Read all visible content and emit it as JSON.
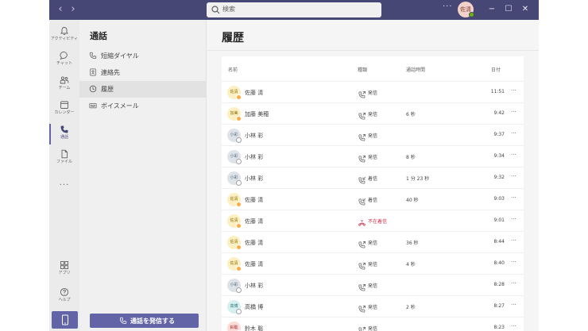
{
  "titlebar": {
    "search_placeholder": "検索",
    "more": "···",
    "avatar_initials": "佐清",
    "back_icon": "‹",
    "forward_icon": "›",
    "minimize": "−",
    "maximize": "☐",
    "close": "✕"
  },
  "appbar": {
    "items": [
      {
        "label": "アクティビティ",
        "icon": "bell-icon"
      },
      {
        "label": "チャット",
        "icon": "chat-icon"
      },
      {
        "label": "チーム",
        "icon": "teams-icon"
      },
      {
        "label": "カレンダー",
        "icon": "calendar-icon"
      },
      {
        "label": "通話",
        "icon": "phone-icon"
      },
      {
        "label": "ファイル",
        "icon": "file-icon"
      }
    ],
    "more": "···",
    "bottom": [
      {
        "label": "アプリ",
        "icon": "apps-icon"
      },
      {
        "label": "ヘルプ",
        "icon": "help-icon"
      }
    ]
  },
  "leftpanel": {
    "title": "通話",
    "items": [
      {
        "label": "短縮ダイヤル",
        "icon": "phone-icon"
      },
      {
        "label": "連絡先",
        "icon": "contact-card-icon"
      },
      {
        "label": "履歴",
        "icon": "clock-icon"
      },
      {
        "label": "ボイスメール",
        "icon": "voicemail-icon"
      }
    ],
    "call_button": "通話を発信する"
  },
  "main": {
    "title": "履歴",
    "columns": {
      "name": "名前",
      "type": "種類",
      "duration": "通話時間",
      "date": "日付"
    },
    "rows": [
      {
        "initials": "佐清",
        "name": "佐藤 清",
        "type": "発信",
        "duration": "",
        "date": "11:51",
        "avatar": "yellow",
        "presence": "away",
        "missed": false
      },
      {
        "initials": "加美",
        "name": "加藤 美穂",
        "type": "発信",
        "duration": "6 秒",
        "date": "9:42",
        "avatar": "yellow",
        "presence": "away",
        "missed": false
      },
      {
        "initials": "小彩",
        "name": "小林 彩",
        "type": "発信",
        "duration": "",
        "date": "9:37",
        "avatar": "gray",
        "presence": "offline",
        "missed": false
      },
      {
        "initials": "小彩",
        "name": "小林 彩",
        "type": "発信",
        "duration": "8 秒",
        "date": "9:34",
        "avatar": "gray",
        "presence": "offline",
        "missed": false
      },
      {
        "initials": "小彩",
        "name": "小林 彩",
        "type": "着信",
        "duration": "1 分 23 秒",
        "date": "9:32",
        "avatar": "gray",
        "presence": "offline",
        "missed": false
      },
      {
        "initials": "佐清",
        "name": "佐藤 清",
        "type": "着信",
        "duration": "40 秒",
        "date": "9:03",
        "avatar": "yellow",
        "presence": "away",
        "missed": false
      },
      {
        "initials": "佐清",
        "name": "佐藤 清",
        "type": "不在着信",
        "duration": "",
        "date": "9:01",
        "avatar": "yellow",
        "presence": "away",
        "missed": true
      },
      {
        "initials": "佐清",
        "name": "佐藤 清",
        "type": "発信",
        "duration": "36 秒",
        "date": "8:44",
        "avatar": "yellow",
        "presence": "away",
        "missed": false
      },
      {
        "initials": "佐清",
        "name": "佐藤 清",
        "type": "発信",
        "duration": "4 秒",
        "date": "8:40",
        "avatar": "yellow",
        "presence": "away",
        "missed": false
      },
      {
        "initials": "小彩",
        "name": "小林 彩",
        "type": "発信",
        "duration": "",
        "date": "8:28",
        "avatar": "gray",
        "presence": "offline",
        "missed": false
      },
      {
        "initials": "高博",
        "name": "高橋 博",
        "type": "発信",
        "duration": "2 秒",
        "date": "8:27",
        "avatar": "teal",
        "presence": "offline",
        "missed": false
      },
      {
        "initials": "鈴聡",
        "name": "鈴木 聡",
        "type": "発信",
        "duration": "",
        "date": "8:23",
        "avatar": "pink",
        "presence": "away",
        "missed": false
      }
    ]
  },
  "colors": {
    "titlebar": "#464775",
    "accent": "#6264a7",
    "missed": "#c4314b",
    "away": "#ffaa44",
    "available": "#6bb700"
  }
}
